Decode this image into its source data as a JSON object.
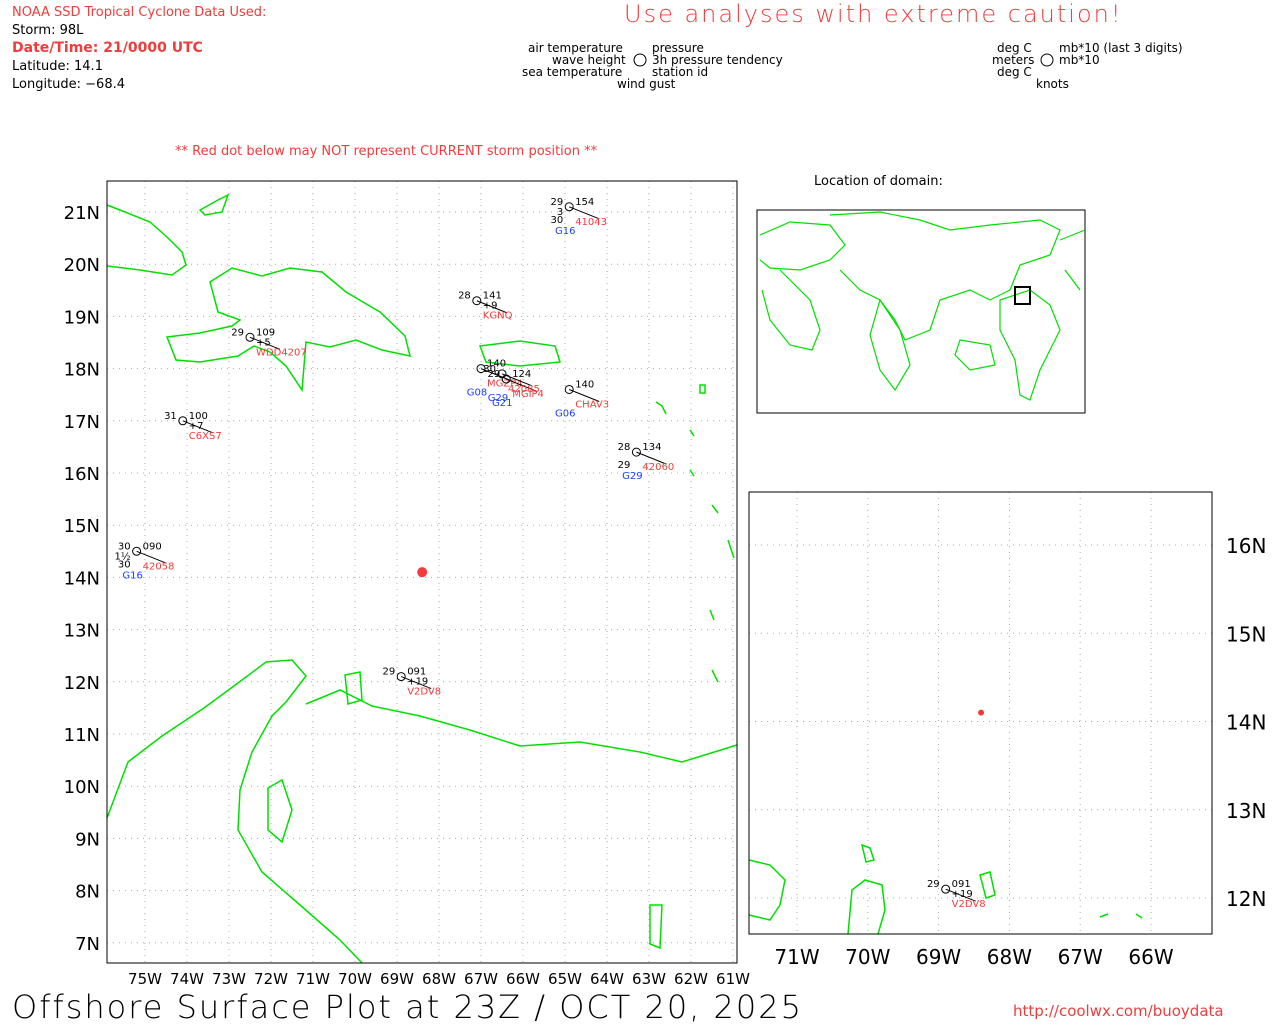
{
  "header": {
    "source": "NOAA SSD Tropical Cyclone Data Used:",
    "storm": "Storm: 98L",
    "datetime": "Date/Time: 21/0000 UTC",
    "latitude": "Latitude: 14.1",
    "longitude": "Longitude: −68.4",
    "warning": "Use analyses with extreme caution!",
    "red_dot_note": "** Red dot below may NOT represent CURRENT storm position **"
  },
  "legend": {
    "left": [
      "air temperature",
      "wave height",
      "sea temperature",
      "wind gust"
    ],
    "right": [
      "pressure",
      "3h pressure tendency",
      "station id"
    ],
    "units_left": [
      "deg C",
      "meters",
      "deg C",
      "knots"
    ],
    "units_right": [
      "mb*10 (last 3 digits)",
      "mb*10"
    ]
  },
  "locator": {
    "title": "Location of domain:"
  },
  "main_map": {
    "lon_range": [
      -75.9,
      -60.9
    ],
    "lat_range": [
      6.6,
      21.6
    ],
    "lon_labels": [
      "75W",
      "74W",
      "73W",
      "72W",
      "71W",
      "70W",
      "69W",
      "68W",
      "67W",
      "66W",
      "65W",
      "64W",
      "63W",
      "62W",
      "61W"
    ],
    "lat_labels": [
      "21N",
      "20N",
      "19N",
      "18N",
      "17N",
      "16N",
      "15N",
      "14N",
      "13N",
      "12N",
      "11N",
      "10N",
      "9N",
      "8N",
      "7N"
    ]
  },
  "zoom_map": {
    "lon_labels": [
      "71W",
      "70W",
      "69W",
      "68W",
      "67W",
      "66W"
    ],
    "lat_labels": [
      "16N",
      "15N",
      "14N",
      "13N",
      "12N"
    ]
  },
  "storm_position": {
    "lat": 14.1,
    "lon": -68.4
  },
  "stations": [
    {
      "id": "41043",
      "lat": 21.1,
      "lon": -64.9,
      "air": "29",
      "pres": "154",
      "wave": "3",
      "sea": "30",
      "gust": "G16"
    },
    {
      "id": "KGNQ",
      "lat": 19.3,
      "lon": -67.1,
      "air": "28",
      "pres": "141",
      "tend": "+9"
    },
    {
      "id": "WDD4207",
      "lat": 18.6,
      "lon": -72.5,
      "air": "29",
      "pres": "109",
      "tend": "+5"
    },
    {
      "id": "C6XS7",
      "lat": 17.0,
      "lon": -74.1,
      "air": "31",
      "pres": "100",
      "tend": "+7"
    },
    {
      "id": "42060",
      "lat": 16.4,
      "lon": -63.3,
      "air": "28",
      "pres": "134",
      "sea": "29",
      "gust": "G29"
    },
    {
      "id": "42058",
      "lat": 14.5,
      "lon": -75.2,
      "air": "30",
      "pres": "090",
      "wave": "1½",
      "sea": "30",
      "gust": "G16"
    },
    {
      "id": "V2DV8",
      "lat": 12.1,
      "lon": -68.9,
      "air": "29",
      "pres": "091",
      "tend": "+19"
    },
    {
      "id": "MGZP4",
      "lat": 18.0,
      "lon": -67.0,
      "air": "",
      "pres": "140",
      "gust": "G08"
    },
    {
      "id": "MGIP4",
      "lat": 17.8,
      "lon": -66.4,
      "air": "29",
      "pres": "124",
      "gust": "G21"
    },
    {
      "id": "42085",
      "lat": 17.9,
      "lon": -66.5,
      "air": "30",
      "pres": "",
      "gust": "G29"
    },
    {
      "id": "CHAV3",
      "lat": 17.6,
      "lon": -64.9,
      "air": "",
      "pres": "140",
      "gust": "G06"
    }
  ],
  "footer": {
    "title": "Offshore Surface Plot at 23Z / OCT 20, 2025",
    "url": "http://coolwx.com/buoydata"
  },
  "colors": {
    "land": "#00e000",
    "station_id": "#f03c3c",
    "gust": "#2040ff",
    "storm": "#f03c3c"
  }
}
